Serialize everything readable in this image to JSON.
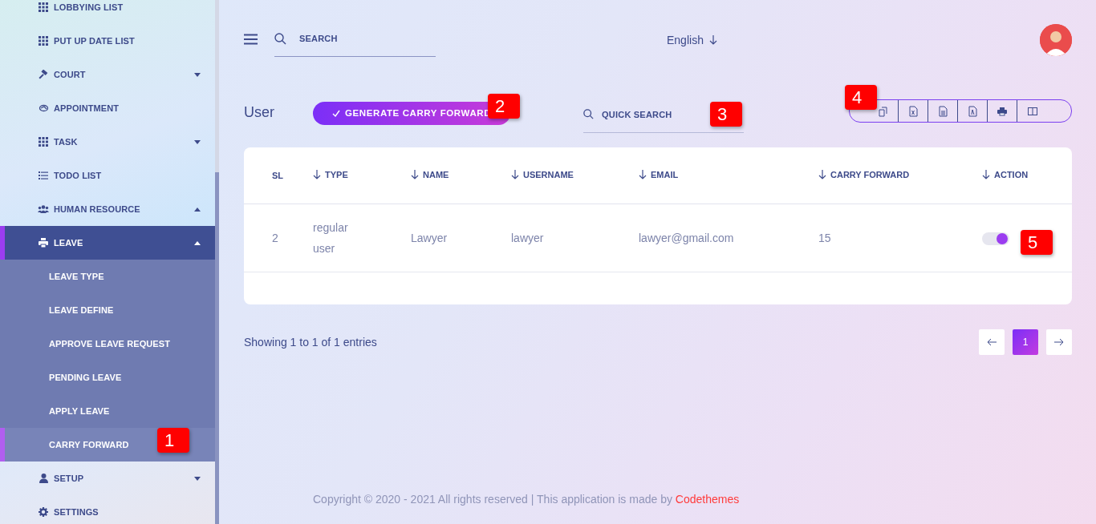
{
  "sidebar": {
    "items": [
      {
        "label": "LOBBYING LIST",
        "selected": false
      },
      {
        "label": "PUT UP DATE LIST",
        "selected": false
      },
      {
        "label": "COURT",
        "selected": false,
        "expanded": false
      },
      {
        "label": "APPOINTMENT",
        "selected": false
      },
      {
        "label": "TASK",
        "selected": false,
        "expanded": false
      },
      {
        "label": "TODO LIST",
        "selected": false
      },
      {
        "label": "HUMAN RESOURCE",
        "selected": false,
        "expanded": true
      },
      {
        "label": "LEAVE",
        "selected": true,
        "expanded": true,
        "children": [
          {
            "label": "LEAVE TYPE",
            "selected": false
          },
          {
            "label": "LEAVE DEFINE",
            "selected": false
          },
          {
            "label": "APPROVE LEAVE REQUEST",
            "selected": false
          },
          {
            "label": "PENDING LEAVE",
            "selected": false
          },
          {
            "label": "APPLY LEAVE",
            "selected": false
          },
          {
            "label": "CARRY FORWARD",
            "selected": true
          }
        ]
      },
      {
        "label": "SETUP",
        "selected": false,
        "expanded": false
      },
      {
        "label": "SETTINGS",
        "selected": false
      }
    ]
  },
  "topbar": {
    "search": {
      "placeholder": "SEARCH"
    },
    "language": "English"
  },
  "page": {
    "title": "User",
    "generate_button": "GENERATE CARRY FORWARD",
    "quick_search": {
      "placeholder": "QUICK SEARCH"
    }
  },
  "table": {
    "columns": [
      {
        "label": "SL",
        "sortable": false
      },
      {
        "label": "TYPE",
        "sortable": true
      },
      {
        "label": "NAME",
        "sortable": true
      },
      {
        "label": "USERNAME",
        "sortable": true
      },
      {
        "label": "EMAIL",
        "sortable": true
      },
      {
        "label": "CARRY FORWARD",
        "sortable": true
      },
      {
        "label": "ACTION",
        "sortable": true
      }
    ],
    "rows": [
      {
        "cells": [
          "2",
          "regular user",
          "Lawyer",
          "lawyer",
          "lawyer@gmail.com",
          "15"
        ],
        "on": true
      }
    ]
  },
  "info": "Showing 1 to 1 of 1 entries",
  "pagination": {
    "pages": [
      {
        "label": "1",
        "selected": true
      }
    ]
  },
  "footer": {
    "text": "Copyright © 2020 - 2021 All rights reserved | This application is made by ",
    "link": "Codethemes"
  },
  "callouts": [
    "1",
    "2",
    "3",
    "4",
    "5"
  ]
}
